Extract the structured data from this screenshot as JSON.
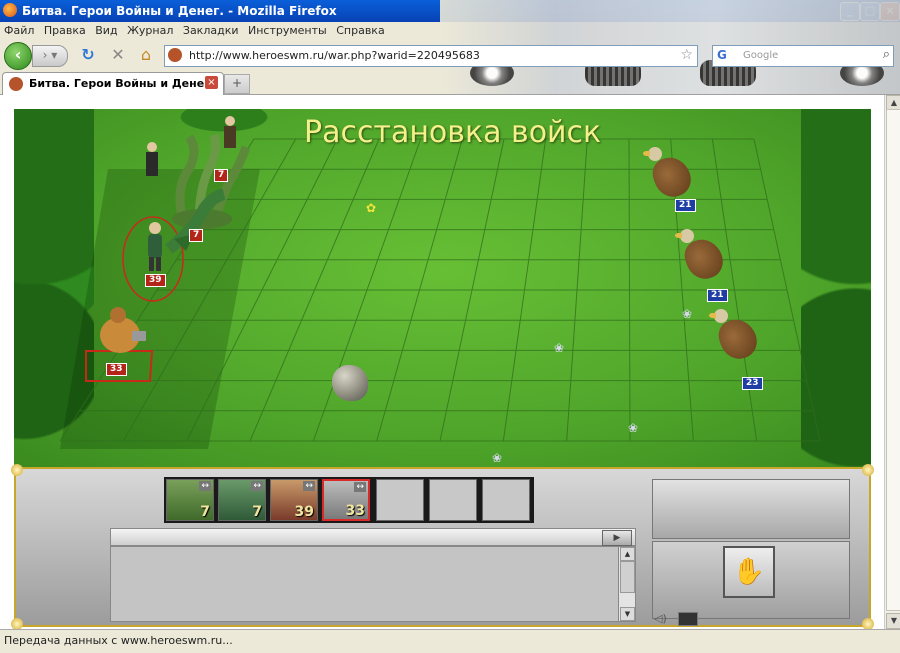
{
  "window": {
    "title": "Битва. Герои Войны и Денег. - Mozilla Firefox",
    "minimize": "_",
    "maximize": "□",
    "close": "×"
  },
  "menu": [
    "Файл",
    "Правка",
    "Вид",
    "Журнал",
    "Закладки",
    "Инструменты",
    "Справка"
  ],
  "nav": {
    "url": "http://www.heroeswm.ru/war.php?warid=220495683",
    "search_placeholder": "Google",
    "search_logo": "G"
  },
  "tab": {
    "label": "Битва. Герои Войны и Денег.",
    "new_tab": "+"
  },
  "battle": {
    "heading": "Расстановка войск",
    "units": [
      {
        "kind": "hydra",
        "side": "player",
        "count": "7"
      },
      {
        "kind": "dragon",
        "side": "player",
        "count": "7"
      },
      {
        "kind": "elf",
        "side": "player",
        "count": "39"
      },
      {
        "kind": "minotaur",
        "side": "player",
        "count": "33"
      },
      {
        "kind": "eagle",
        "side": "enemy",
        "count": "21"
      },
      {
        "kind": "eagle",
        "side": "enemy",
        "count": "21"
      },
      {
        "kind": "eagle",
        "side": "enemy",
        "count": "23"
      }
    ],
    "colors": {
      "player_count": "#b32518",
      "enemy_count": "#1f3ea5",
      "grid": "#2f6e1c"
    }
  },
  "queue": [
    {
      "unit": "hydra",
      "count": "7",
      "active": false
    },
    {
      "unit": "dragon",
      "count": "7",
      "active": false
    },
    {
      "unit": "elf",
      "count": "39",
      "active": false
    },
    {
      "unit": "minotaur",
      "count": "33",
      "active": true
    },
    {
      "unit": "",
      "count": "",
      "active": false
    },
    {
      "unit": "",
      "count": "",
      "active": false
    },
    {
      "unit": "",
      "count": "",
      "active": false
    }
  ],
  "status": "Передача данных с www.heroeswm.ru..."
}
